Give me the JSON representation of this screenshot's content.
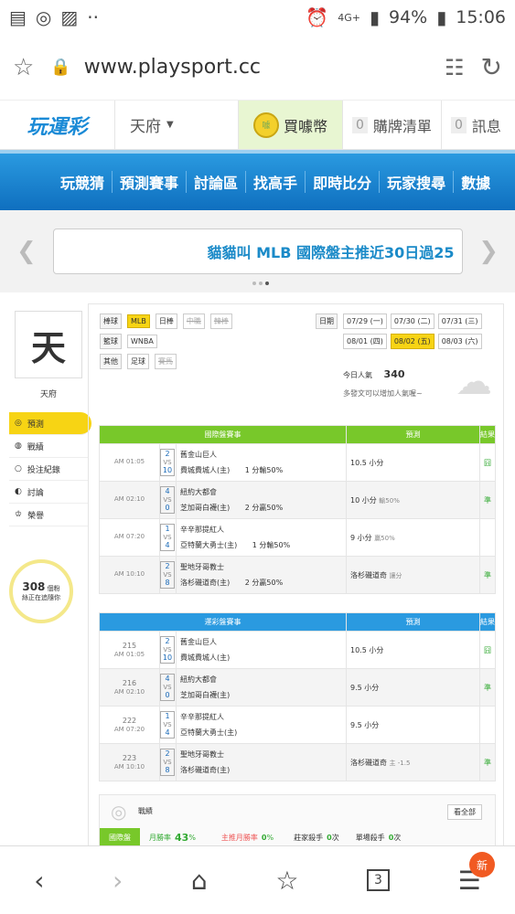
{
  "status": {
    "network": "4G+",
    "battery": "94%",
    "time": "15:06"
  },
  "browser": {
    "url": "www.playsport.cc"
  },
  "header": {
    "logo": "玩運彩",
    "region": "天府",
    "buy_coin": "買噱幣",
    "cart_count": "0",
    "cart": "購牌清單",
    "msg_count": "0",
    "messages": "訊息"
  },
  "nav": [
    "玩競猜",
    "預測賽事",
    "討論區",
    "找高手",
    "即時比分",
    "玩家搜尋",
    "數據"
  ],
  "banner": {
    "text": "貓貓叫 MLB 國際盤主推近30日過25"
  },
  "user": {
    "avatar_char": "天",
    "name": "天府",
    "glow_count": "308",
    "glow_text1": "個粉",
    "glow_text2": "絲正在追隨你"
  },
  "menu": [
    "預測",
    "戰績",
    "投注紀錄",
    "討論",
    "榮譽"
  ],
  "filters": {
    "baseball_label": "棒球",
    "baseball": [
      "MLB",
      "日棒",
      "中職",
      "韓棒"
    ],
    "basketball_label": "籃球",
    "basketball": [
      "WNBA"
    ],
    "other_label": "其他",
    "other": [
      "足球",
      "賽馬"
    ],
    "date_label": "日期",
    "dates": [
      "07/29 (一)",
      "07/30 (二)",
      "07/31 (三)",
      "08/01 (四)",
      "08/02 (五)",
      "08/03 (六)"
    ],
    "popularity_label": "今日人氣",
    "popularity": "340",
    "popularity_hint": "多發文可以增加人氣喔~"
  },
  "intl_table": {
    "headers": [
      "國際盤賽事",
      "預測",
      "結果"
    ],
    "rows": [
      {
        "id": "",
        "time": "AM 01:05",
        "s1": "2",
        "s2": "10",
        "t1": "舊金山巨人",
        "t2": "費城費城人(主)",
        "line": "1 分輸50%",
        "pred": "10.5 小分",
        "pnote": "",
        "res": "囧"
      },
      {
        "id": "",
        "time": "AM 02:10",
        "s1": "4",
        "s2": "0",
        "t1": "紐約大都會",
        "t2": "芝加哥白襪(主)",
        "line": "2 分贏50%",
        "pred": "10 小分",
        "pnote": "輸50%",
        "res": "準"
      },
      {
        "id": "",
        "time": "AM 07:20",
        "s1": "1",
        "s2": "4",
        "t1": "辛辛那提紅人",
        "t2": "亞特蘭大勇士(主)",
        "line": "1 分輸50%",
        "pred": "9 小分",
        "pnote": "贏50%",
        "res": ""
      },
      {
        "id": "",
        "time": "AM 10:10",
        "s1": "2",
        "s2": "8",
        "t1": "聖地牙哥教士",
        "t2": "洛杉磯道奇(主)",
        "line": "2 分贏50%",
        "pred": "洛杉磯道奇",
        "pnote": "讓分",
        "res": "準"
      }
    ]
  },
  "lottery_table": {
    "headers": [
      "運彩盤賽事",
      "預測",
      "結果"
    ],
    "rows": [
      {
        "id": "215",
        "time": "AM 01:05",
        "s1": "2",
        "s2": "10",
        "t1": "舊金山巨人",
        "t2": "費城費城人(主)",
        "line": "",
        "pred": "10.5 小分",
        "pnote": "",
        "res": "囧"
      },
      {
        "id": "216",
        "time": "AM 02:10",
        "s1": "4",
        "s2": "0",
        "t1": "紐約大都會",
        "t2": "芝加哥白襪(主)",
        "line": "",
        "pred": "9.5 小分",
        "pnote": "",
        "res": "準"
      },
      {
        "id": "222",
        "time": "AM 07:20",
        "s1": "1",
        "s2": "4",
        "t1": "辛辛那提紅人",
        "t2": "亞特蘭大勇士(主)",
        "line": "",
        "pred": "9.5 小分",
        "pnote": "",
        "res": ""
      },
      {
        "id": "223",
        "time": "AM 10:10",
        "s1": "2",
        "s2": "8",
        "t1": "聖地牙哥教士",
        "t2": "洛杉磯道奇(主)",
        "line": "",
        "pred": "洛杉磯道奇",
        "pnote": "主 -1.5",
        "res": "準"
      }
    ]
  },
  "stats": {
    "title": "戰績",
    "view_all": "看全部",
    "intl": "國際盤",
    "monthly": "月勝率",
    "monthly_val": "43",
    "pct": "%",
    "main_monthly": "主推月勝率",
    "main_val": "0",
    "banker": "莊家殺手",
    "banker_val": "0",
    "unit": "次",
    "single": "單場殺手",
    "single_val": "0"
  },
  "bottom": {
    "badge": "新",
    "tabs": "3"
  }
}
